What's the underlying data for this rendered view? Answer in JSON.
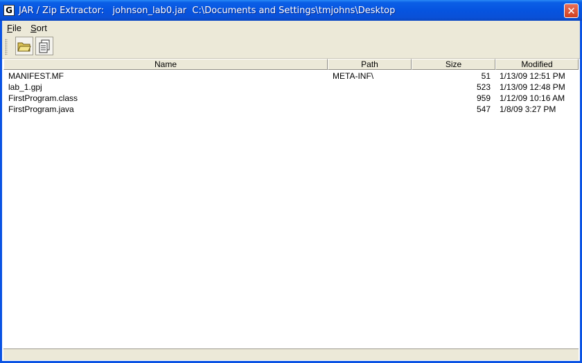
{
  "window": {
    "title": "JAR / Zip Extractor:   johnson_lab0.jar  C:\\Documents and Settings\\tmjohns\\Desktop",
    "app_icon_glyph": "G",
    "close_glyph": "✕",
    "accent": "#0654e0"
  },
  "menu": {
    "items": [
      {
        "label": "File",
        "mnemonic": "F"
      },
      {
        "label": "Sort",
        "mnemonic": "S"
      }
    ]
  },
  "toolbar": {
    "buttons": [
      {
        "icon": "open-folder-icon"
      },
      {
        "icon": "extract-document-icon"
      }
    ]
  },
  "table": {
    "columns": [
      "Name",
      "Path",
      "Size",
      "Modified"
    ],
    "rows": [
      {
        "name": "MANIFEST.MF",
        "path": "META-INF\\",
        "size": "51",
        "modified": "1/13/09 12:51 PM"
      },
      {
        "name": "lab_1.gpj",
        "path": "",
        "size": "523",
        "modified": "1/13/09 12:48 PM"
      },
      {
        "name": "FirstProgram.class",
        "path": "",
        "size": "959",
        "modified": "1/12/09 10:16 AM"
      },
      {
        "name": "FirstProgram.java",
        "path": "",
        "size": "547",
        "modified": "1/8/09 3:27 PM"
      }
    ]
  },
  "status": {
    "text": ""
  }
}
